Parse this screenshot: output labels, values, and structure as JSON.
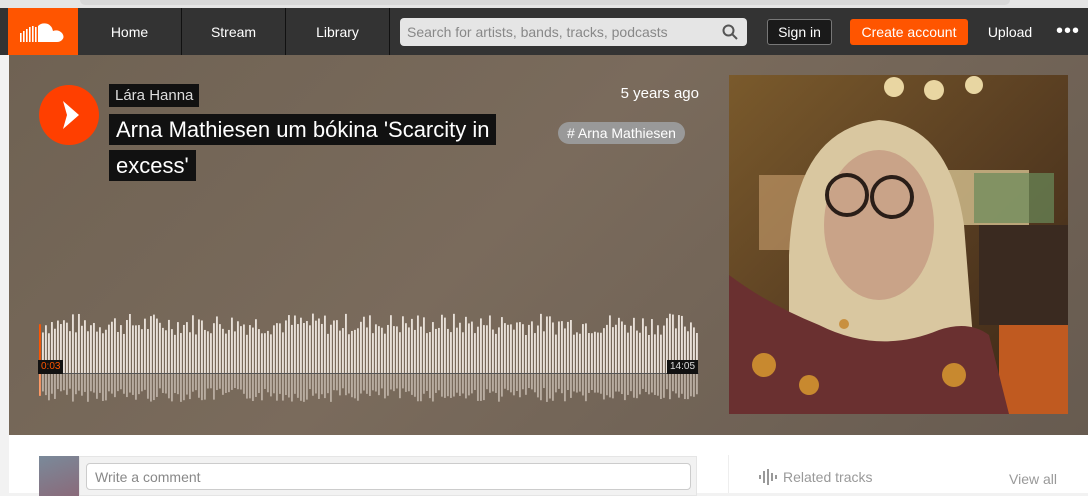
{
  "nav": {
    "logo": "soundcloud-logo",
    "links": [
      "Home",
      "Stream",
      "Library"
    ],
    "search_placeholder": "Search for artists, bands, tracks, podcasts",
    "sign_in": "Sign in",
    "create_account": "Create account",
    "upload": "Upload",
    "more": "•••"
  },
  "track": {
    "artist": "Lára Hanna",
    "title": "Arna Mathiesen um bókina 'Scarcity in excess'",
    "posted": "5 years ago",
    "tag": "# Arna Mathiesen",
    "current_time": "0:03",
    "duration": "14:05",
    "progress_fraction": 0.0035
  },
  "comment": {
    "placeholder": "Write a comment"
  },
  "sidebar": {
    "related_title": "Related tracks",
    "view_all": "View all"
  },
  "colors": {
    "brand": "#ff5500",
    "navbar": "#333333",
    "hero": "#75685a"
  },
  "icons": [
    "soundcloud-logo",
    "search-icon",
    "play-icon",
    "waveform-icon",
    "more-icon"
  ]
}
